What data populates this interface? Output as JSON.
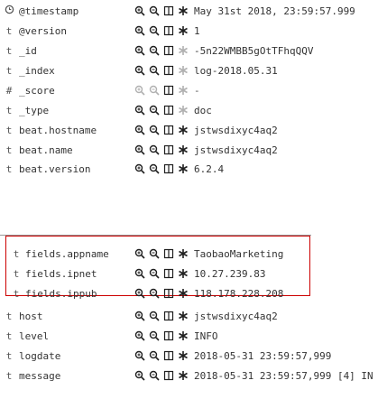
{
  "colors": {
    "icon": "#1f1f1f",
    "highlight_border": "#cc0000"
  },
  "rows": [
    {
      "type_icon": "clock-icon",
      "field": "@timestamp",
      "value": "May 31st 2018, 23:59:57.999"
    },
    {
      "type_icon": "text-type",
      "type_label": "t",
      "field": "@version",
      "value": "1"
    },
    {
      "type_icon": "text-type",
      "type_label": "t",
      "field": "_id",
      "value": "-5n22WMBB5gOtTFhqQQV"
    },
    {
      "type_icon": "text-type",
      "type_label": "t",
      "field": "_index",
      "value": "log-2018.05.31"
    },
    {
      "type_icon": "number-type",
      "type_label": "#",
      "field": "_score",
      "value": "-"
    },
    {
      "type_icon": "text-type",
      "type_label": "t",
      "field": "_type",
      "value": "doc"
    },
    {
      "type_icon": "text-type",
      "type_label": "t",
      "field": "beat.hostname",
      "value": "jstwsdixyc4aq2"
    },
    {
      "type_icon": "text-type",
      "type_label": "t",
      "field": "beat.name",
      "value": "jstwsdixyc4aq2"
    },
    {
      "type_icon": "text-type",
      "type_label": "t",
      "field": "beat.version",
      "value": "6.2.4"
    },
    {
      "type_icon": "text-type",
      "type_label": "t",
      "field": "fields.appname",
      "value": "TaobaoMarketing"
    },
    {
      "type_icon": "text-type",
      "type_label": "t",
      "field": "fields.ipnet",
      "value": "10.27.239.83"
    },
    {
      "type_icon": "text-type",
      "type_label": "t",
      "field": "fields.ippub",
      "value": "118.178.228.208"
    },
    {
      "type_icon": "text-type",
      "type_label": "t",
      "field": "host",
      "value": "jstwsdixyc4aq2"
    },
    {
      "type_icon": "text-type",
      "type_label": "t",
      "field": "level",
      "value": "INFO"
    },
    {
      "type_icon": "text-type",
      "type_label": "t",
      "field": "logdate",
      "value": "2018-05-31 23:59:57,999"
    },
    {
      "type_icon": "text-type",
      "type_label": "t",
      "field": "message",
      "value": "2018-05-31 23:59:57,999 [4] IN"
    }
  ],
  "action_icons": [
    "filter-for-value-icon",
    "filter-out-value-icon",
    "toggle-column-icon",
    "filter-exists-icon"
  ]
}
